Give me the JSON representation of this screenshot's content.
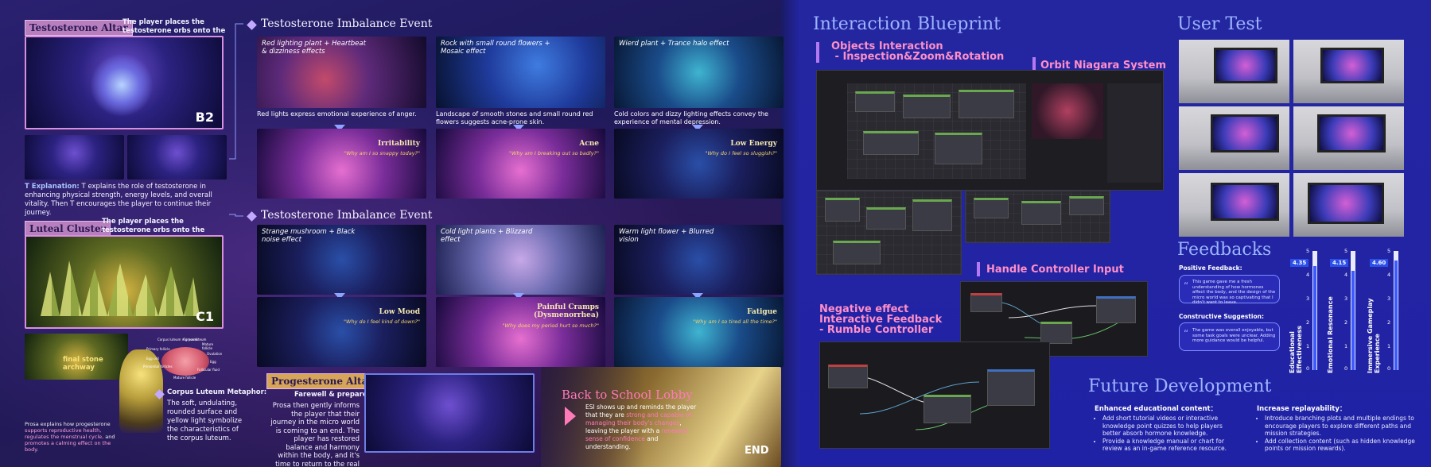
{
  "left": {
    "testosterone_altar": {
      "label": "Testosterone Altar",
      "desc": "The player places the testosterone orbs onto the altar.",
      "badge": "B2",
      "explanation_label": "T Explanation:",
      "explanation": " T explains the role of testosterone in enhancing physical strength, energy levels, and overall vitality. Then T encourages the player to continue their journey."
    },
    "luteal_cluster": {
      "label": "Luteal Cluster",
      "desc": "The player places the testosterone orbs onto the altar.",
      "badge": "C1",
      "archway": "final stone archway",
      "metaphor_title": "Corpus Luteum Metaphor:",
      "metaphor": "The soft, undulating, rounded surface and yellow light symbolize the characteristics of the corpus luteum.",
      "prosa_note_a": "Prosa explains how progesterone ",
      "prosa_note_b": "supports reproductive health, regulates the menstrual cycle,",
      "prosa_note_c": " and ",
      "prosa_note_d": "promotes a calming effect on the body."
    },
    "ovary_labels": [
      "Corpus luteum regressed",
      "Corpus luteum",
      "Mature follicle",
      "Primary follicle",
      "Ovulation",
      "Egg cell",
      "Primordial follicles",
      "Egg",
      "Follicular fluid",
      "Mature follicle"
    ],
    "event1": {
      "title": "Testosterone Imbalance Event",
      "items": [
        {
          "trigger": "Red lighting plant + Heartbeat & dizziness effects",
          "caption": "Red lights express emotional experience of anger.",
          "scene_title": "Irritability",
          "scene_sub": "\"Why am I so snappy today?\""
        },
        {
          "trigger": "Rock with small round flowers + Mosaic effect",
          "caption": "Landscape of smooth stones and small round red flowers suggests acne-prone skin.",
          "scene_title": "Acne",
          "scene_sub": "\"Why am I breaking out so badly?\""
        },
        {
          "trigger": "Wierd plant + Trance halo effect",
          "caption": "Cold colors and dizzy lighting effects convey the experience of mental depression.",
          "scene_title": "Low Energy",
          "scene_sub": "\"Why do I feel so sluggish?\""
        }
      ]
    },
    "event2": {
      "title": "Testosterone Imbalance Event",
      "items": [
        {
          "trigger": "Strange mushroom + Black noise effect",
          "scene_title": "Low Mood",
          "scene_sub": "\"Why do I feel kind of down?\""
        },
        {
          "trigger": "Cold light plants + Blizzard effect",
          "scene_title": "Painful Cramps (Dysmenorrhea)",
          "scene_sub": "\"Why does my period hurt so much?\""
        },
        {
          "trigger": "Warm light flower + Blurred vision",
          "scene_title": "Fatigue",
          "scene_sub": "\"Why am I so tired all the time?\""
        }
      ]
    },
    "progesterone_altar": {
      "label": "Progesterone Altar",
      "sub": "Farewell & prepare back",
      "text": "Prosa then gently informs the player that their journey in the micro world is coming to an end. The player has restored balance and harmony within the body, and it's time to return to the real world."
    },
    "lobby": {
      "title": "Back to School Lobby",
      "text_a": "ESI shows up and reminds the player that they are ",
      "text_b": "strong and capable of managing their body's changes",
      "text_c": ", leaving the player with a ",
      "text_d": "renewed sense of confidence",
      "text_e": " and understanding.",
      "end": "END"
    }
  },
  "right": {
    "blueprint_title": "Interaction Blueprint",
    "objects_title": "Objects Interaction\n - Inspection&Zoom&Rotation",
    "orbit_title": "Orbit Niagara System",
    "handle_title": "Handle Controller Input",
    "negative_title": "Negative effect\nInteractive Feedback\n- Rumble Controller",
    "user_test_title": "User Test",
    "feedbacks_title": "Feedbacks",
    "positive_label": "Positive Feedback:",
    "positive_text": "This game gave me a fresh understanding of how hormones affect the body, and the design of the micro world was so captivating that I didn't want to leave.",
    "constructive_label": "Constructive Suggestion:",
    "constructive_text": "The game was overall enjoyable, but some task goals were unclear. Adding more guidance would be helpful.",
    "ratings": [
      {
        "label": "Educational Effectiveness",
        "value": "4.35",
        "score": 4.35
      },
      {
        "label": "Emotional Resonance",
        "value": "4.15",
        "score": 4.15
      },
      {
        "label": "Immersive Gameplay Experience",
        "value": "4.60",
        "score": 4.6
      }
    ],
    "scale_ticks": [
      "5",
      "4",
      "3",
      "2",
      "1",
      "0"
    ],
    "future_title": "Future Development",
    "future_a_title": "Enhanced educational content：",
    "future_a_items": [
      "Add short tutorial videos or interactive knowledge point quizzes to help players better absorb hormone knowledge.",
      "Provide a knowledge manual or chart for review as an in-game reference resource."
    ],
    "future_b_title": "Increase replayability：",
    "future_b_items": [
      "Introduce branching plots and multiple endings to encourage players to explore different paths and mission strategies.",
      "Add collection content (such as hidden knowledge points or mission rewards)."
    ]
  },
  "colors": {
    "accent_pink": "#ff8fc8",
    "title_blue": "#9cb4ff",
    "panel_blue": "#2022a6"
  }
}
